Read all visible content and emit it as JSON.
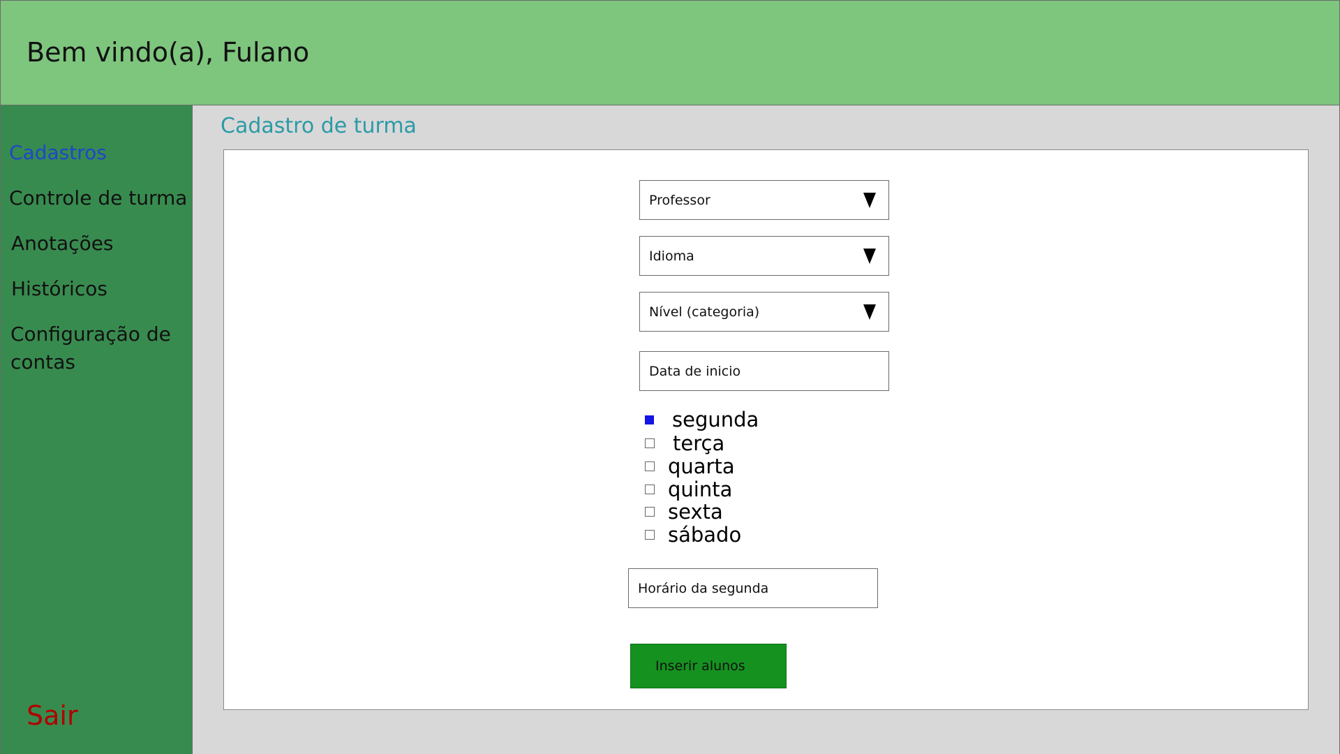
{
  "header": {
    "title": "Bem vindo(a), Fulano"
  },
  "sidebar": {
    "items": [
      {
        "label": "Cadastros",
        "active": true
      },
      {
        "label": "Controle de turma",
        "active": false
      },
      {
        "label": "Anotações",
        "active": false
      },
      {
        "label": "Históricos",
        "active": false
      },
      {
        "label": "Configuração de contas",
        "active": false
      }
    ],
    "logout_label": "Sair"
  },
  "main": {
    "title": "Cadastro de turma",
    "form": {
      "professor": {
        "value": "Professor",
        "icon": "dropdown-caret-icon"
      },
      "idioma": {
        "value": "Idioma",
        "icon": "dropdown-caret-icon"
      },
      "nivel": {
        "value": "Nível (categoria)",
        "icon": "dropdown-caret-icon"
      },
      "data_inicio": {
        "placeholder": "Data de inicio"
      },
      "days": [
        {
          "label": "segunda",
          "checked": true
        },
        {
          "label": "terça",
          "checked": false
        },
        {
          "label": "quarta",
          "checked": false
        },
        {
          "label": "quinta",
          "checked": false
        },
        {
          "label": "sexta",
          "checked": false
        },
        {
          "label": "sábado",
          "checked": false
        }
      ],
      "horario": {
        "placeholder": "Horário da segunda"
      },
      "submit_label": "Inserir alunos"
    }
  },
  "colors": {
    "header_bg": "#7ec57e",
    "sidebar_bg": "#388b4f",
    "content_bg": "#d9d8d9",
    "active_nav": "#1f47c9",
    "title": "#2a9ba5",
    "logout": "#b00000",
    "button_bg": "#15911f",
    "checked": "#1414e6"
  }
}
